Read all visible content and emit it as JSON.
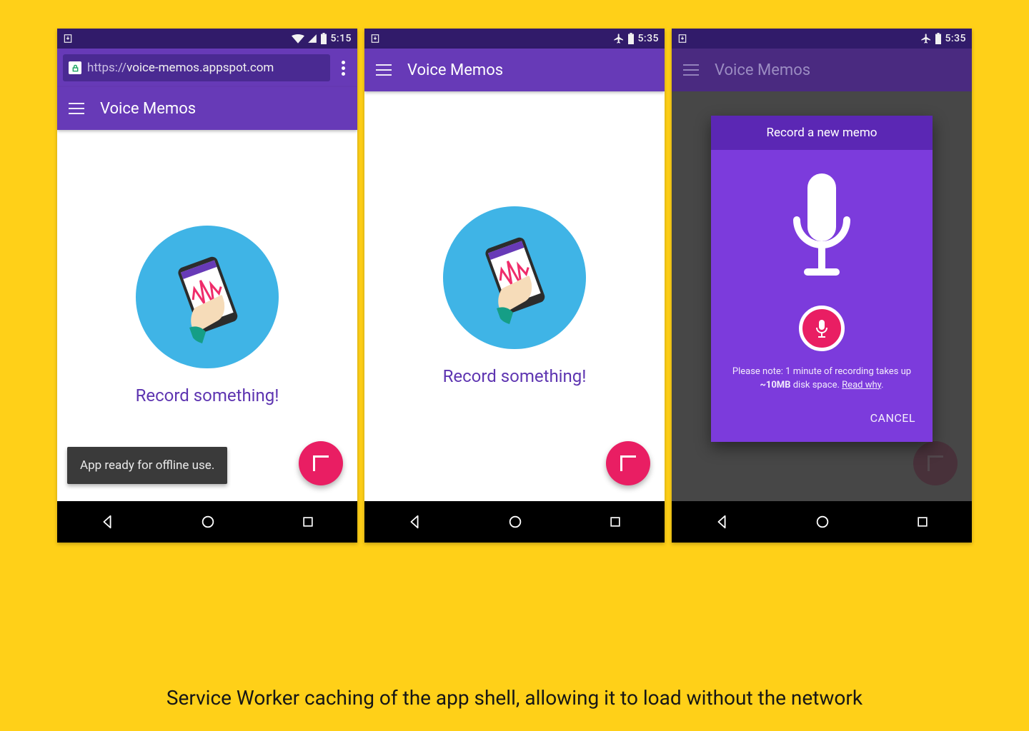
{
  "caption": "Service Worker caching of the app shell, allowing it to load without the network",
  "app_title": "Voice Memos",
  "url_prefix": "https://",
  "url_domain": "voice-memos.appspot.com",
  "prompt_text": "Record something!",
  "toast_text": "App ready for offline use.",
  "dialog": {
    "title": "Record a new memo",
    "note_prefix": "Please note: 1 minute of recording takes up",
    "note_size": "~10MB",
    "note_suffix": "disk space.",
    "note_link": "Read why",
    "cancel": "CANCEL"
  },
  "status": {
    "time1": "5:15",
    "time2": "5:35",
    "time3": "5:35"
  },
  "colors": {
    "accent": "#673ab7",
    "accent_dark": "#311b6a",
    "fab": "#e91e63",
    "bg": "#ffd018",
    "dialog_bg": "#7c3bdc"
  }
}
